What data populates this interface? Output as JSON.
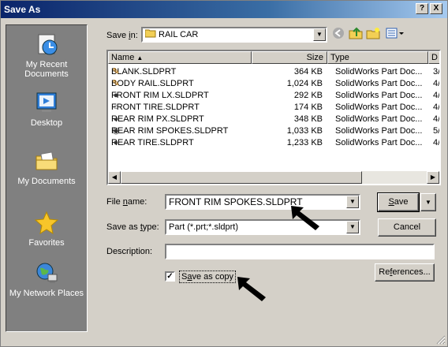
{
  "window": {
    "title": "Save As",
    "help_glyph": "?",
    "close_glyph": "X"
  },
  "places": [
    {
      "label": "My Recent Documents",
      "icon": "recent-documents-icon"
    },
    {
      "label": "Desktop",
      "icon": "desktop-icon"
    },
    {
      "label": "My Documents",
      "icon": "my-documents-icon"
    },
    {
      "label": "Favorites",
      "icon": "favorites-icon"
    },
    {
      "label": "My Network Places",
      "icon": "network-places-icon"
    }
  ],
  "save_in": {
    "label": "Save in:",
    "label_prefix": "Save ",
    "label_key": "i",
    "label_suffix": "n:",
    "value": "RAIL CAR"
  },
  "toolbar": {
    "back": "back-icon",
    "up": "up-folder-icon",
    "new_folder": "new-folder-icon",
    "views": "views-menu-icon"
  },
  "columns": {
    "name": "Name",
    "size": "Size",
    "type": "Type",
    "date": "D"
  },
  "files": [
    {
      "name": "BLANK.SLDPRT",
      "size": "364 KB",
      "type": "SolidWorks Part Doc...",
      "date": "3/"
    },
    {
      "name": "BODY RAIL.SLDPRT",
      "size": "1,024 KB",
      "type": "SolidWorks Part Doc...",
      "date": "4/"
    },
    {
      "name": "FRONT RIM LX.SLDPRT",
      "size": "292 KB",
      "type": "SolidWorks Part Doc...",
      "date": "4/"
    },
    {
      "name": "FRONT TIRE.SLDPRT",
      "size": "174 KB",
      "type": "SolidWorks Part Doc...",
      "date": "4/"
    },
    {
      "name": "REAR RIM PX.SLDPRT",
      "size": "348 KB",
      "type": "SolidWorks Part Doc...",
      "date": "4/"
    },
    {
      "name": "REAR RIM SPOKES.SLDPRT",
      "size": "1,033 KB",
      "type": "SolidWorks Part Doc...",
      "date": "5/"
    },
    {
      "name": "REAR TIRE.SLDPRT",
      "size": "1,233 KB",
      "type": "SolidWorks Part Doc...",
      "date": "4/"
    }
  ],
  "form": {
    "file_name_prefix": "File ",
    "file_name_key": "n",
    "file_name_suffix": "ame:",
    "file_name_value": "FRONT RIM SPOKES.SLDPRT",
    "save_type_prefix": "Save as ",
    "save_type_key": "t",
    "save_type_suffix": "ype:",
    "save_type_value": "Part (*.prt;*.sldprt)",
    "description_label": "Description:",
    "description_value": "",
    "save_copy_prefix": "S",
    "save_copy_key": "a",
    "save_copy_suffix": "ve as copy",
    "save_copy_checked": true
  },
  "buttons": {
    "save_key": "S",
    "save_rest": "ave",
    "cancel": "Cancel",
    "references_prefix": "Re",
    "references_key": "f",
    "references_suffix": "erences..."
  }
}
